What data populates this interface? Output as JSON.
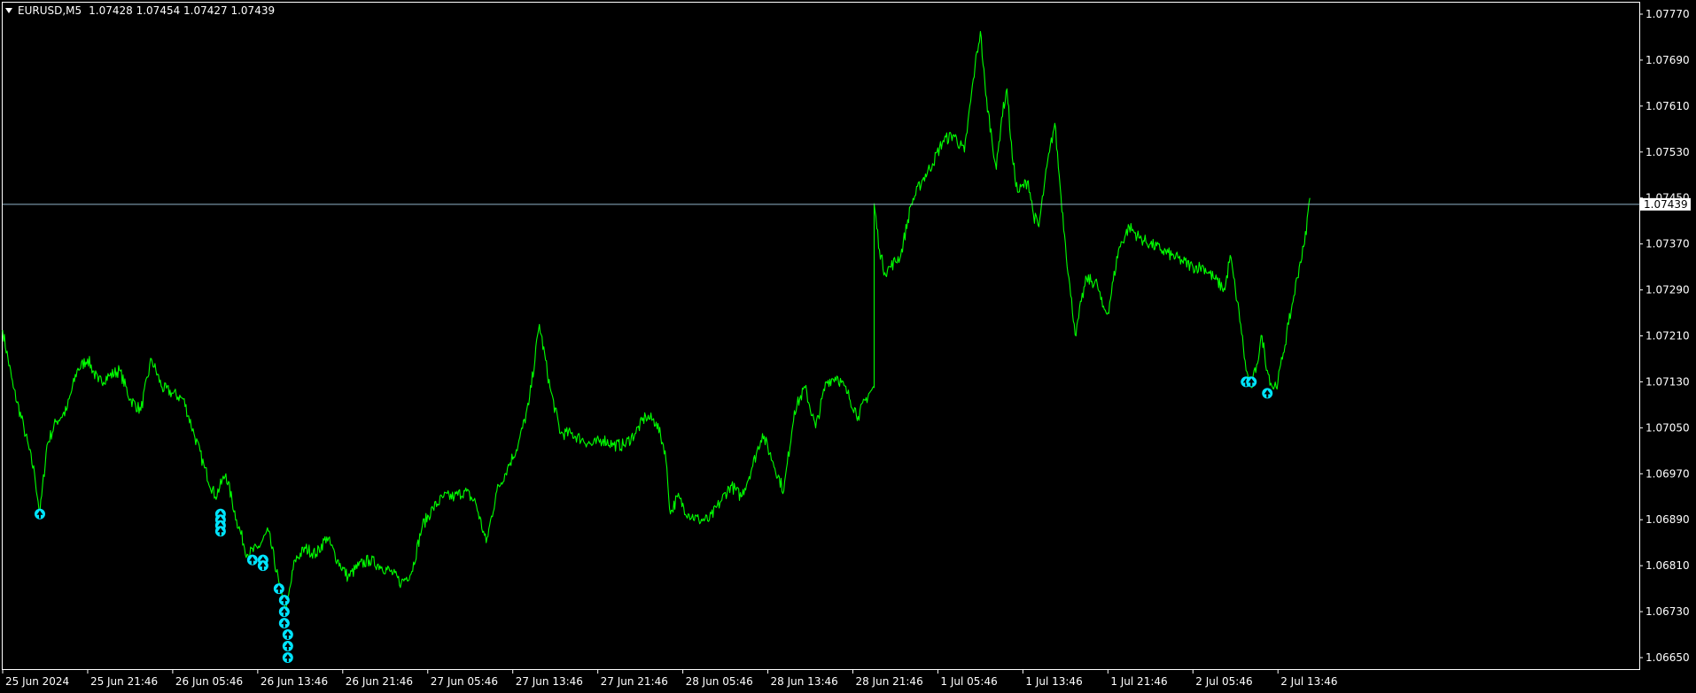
{
  "header": {
    "symbol": "EURUSD,M5",
    "ohlc": "1.07428 1.07454 1.07427 1.07439"
  },
  "chart_data": {
    "type": "line",
    "title": "EURUSD,M5  1.07428 1.07454 1.07427 1.07439",
    "ylim": [
      1.0663,
      1.0779
    ],
    "y_ticks": [
      "1.07770",
      "1.07690",
      "1.07610",
      "1.07530",
      "1.07450",
      "1.07370",
      "1.07290",
      "1.07210",
      "1.07130",
      "1.07050",
      "1.06970",
      "1.06890",
      "1.06810",
      "1.06730",
      "1.06650"
    ],
    "y_tick_values": [
      1.0777,
      1.0769,
      1.0761,
      1.0753,
      1.0745,
      1.0737,
      1.0729,
      1.0721,
      1.0713,
      1.0705,
      1.0697,
      1.0689,
      1.0681,
      1.0673,
      1.0665
    ],
    "x_ticks": [
      "25 Jun 2024",
      "25 Jun 21:46",
      "26 Jun 05:46",
      "26 Jun 13:46",
      "26 Jun 21:46",
      "27 Jun 05:46",
      "27 Jun 13:46",
      "27 Jun 21:46",
      "28 Jun 05:46",
      "28 Jun 13:46",
      "28 Jun 21:46",
      "1 Jul 05:46",
      "1 Jul 13:46",
      "1 Jul 21:46",
      "2 Jul 05:46",
      "2 Jul 13:46"
    ],
    "x_tick_index": [
      0,
      96,
      192,
      288,
      384,
      480,
      576,
      672,
      768,
      864,
      960,
      1056,
      1152,
      1248,
      1344,
      1440
    ],
    "current_price": 1.07439,
    "current_price_label": "1.07439",
    "series": [
      {
        "color": "#00ff00",
        "points": [
          [
            0,
            1.0722
          ],
          [
            12,
            1.0712
          ],
          [
            24,
            1.0705
          ],
          [
            36,
            1.0697
          ],
          [
            42,
            1.069
          ],
          [
            50,
            1.0702
          ],
          [
            60,
            1.0706
          ],
          [
            72,
            1.0708
          ],
          [
            84,
            1.0715
          ],
          [
            96,
            1.0717
          ],
          [
            108,
            1.0713
          ],
          [
            120,
            1.0714
          ],
          [
            132,
            1.0715
          ],
          [
            144,
            1.071
          ],
          [
            156,
            1.0708
          ],
          [
            168,
            1.0717
          ],
          [
            180,
            1.0712
          ],
          [
            192,
            1.0711
          ],
          [
            204,
            1.071
          ],
          [
            216,
            1.0704
          ],
          [
            228,
            1.0698
          ],
          [
            240,
            1.0693
          ],
          [
            252,
            1.0697
          ],
          [
            264,
            1.0689
          ],
          [
            276,
            1.0683
          ],
          [
            288,
            1.0684
          ],
          [
            300,
            1.0687
          ],
          [
            312,
            1.0678
          ],
          [
            320,
            1.0673
          ],
          [
            330,
            1.0682
          ],
          [
            342,
            1.0684
          ],
          [
            354,
            1.0683
          ],
          [
            366,
            1.0686
          ],
          [
            378,
            1.0682
          ],
          [
            390,
            1.0679
          ],
          [
            402,
            1.0681
          ],
          [
            414,
            1.0682
          ],
          [
            426,
            1.0681
          ],
          [
            438,
            1.068
          ],
          [
            450,
            1.0678
          ],
          [
            462,
            1.068
          ],
          [
            474,
            1.0688
          ],
          [
            486,
            1.0691
          ],
          [
            498,
            1.0693
          ],
          [
            510,
            1.0693
          ],
          [
            522,
            1.0694
          ],
          [
            534,
            1.0692
          ],
          [
            546,
            1.0685
          ],
          [
            558,
            1.0694
          ],
          [
            570,
            1.0698
          ],
          [
            582,
            1.0702
          ],
          [
            594,
            1.0709
          ],
          [
            606,
            1.0723
          ],
          [
            618,
            1.0712
          ],
          [
            630,
            1.0704
          ],
          [
            642,
            1.0704
          ],
          [
            654,
            1.0703
          ],
          [
            666,
            1.0702
          ],
          [
            678,
            1.0703
          ],
          [
            690,
            1.0702
          ],
          [
            702,
            1.0702
          ],
          [
            714,
            1.0704
          ],
          [
            726,
            1.0707
          ],
          [
            738,
            1.0706
          ],
          [
            748,
            1.0701
          ],
          [
            754,
            1.069
          ],
          [
            762,
            1.0693
          ],
          [
            774,
            1.069
          ],
          [
            786,
            1.0689
          ],
          [
            798,
            1.0689
          ],
          [
            810,
            1.0692
          ],
          [
            822,
            1.0695
          ],
          [
            834,
            1.0693
          ],
          [
            846,
            1.0698
          ],
          [
            858,
            1.0704
          ],
          [
            870,
            1.0699
          ],
          [
            882,
            1.0694
          ],
          [
            894,
            1.0708
          ],
          [
            906,
            1.0712
          ],
          [
            918,
            1.0705
          ],
          [
            930,
            1.0713
          ],
          [
            942,
            1.0714
          ],
          [
            954,
            1.0711
          ],
          [
            966,
            1.0707
          ],
          [
            978,
            1.0711
          ],
          [
            984,
            1.0712
          ],
          [
            984,
            1.0744
          ],
          [
            990,
            1.0736
          ],
          [
            996,
            1.0732
          ],
          [
            1002,
            1.0733
          ],
          [
            1014,
            1.0735
          ],
          [
            1026,
            1.0744
          ],
          [
            1038,
            1.0748
          ],
          [
            1050,
            1.0751
          ],
          [
            1062,
            1.0755
          ],
          [
            1074,
            1.0756
          ],
          [
            1086,
            1.0753
          ],
          [
            1098,
            1.0768
          ],
          [
            1104,
            1.0774
          ],
          [
            1110,
            1.0763
          ],
          [
            1122,
            1.075
          ],
          [
            1128,
            1.0759
          ],
          [
            1134,
            1.0764
          ],
          [
            1140,
            1.0752
          ],
          [
            1146,
            1.0746
          ],
          [
            1158,
            1.0748
          ],
          [
            1164,
            1.0742
          ],
          [
            1170,
            1.074
          ],
          [
            1176,
            1.0747
          ],
          [
            1182,
            1.0753
          ],
          [
            1188,
            1.0758
          ],
          [
            1194,
            1.0747
          ],
          [
            1200,
            1.0737
          ],
          [
            1206,
            1.0728
          ],
          [
            1212,
            1.0721
          ],
          [
            1218,
            1.0727
          ],
          [
            1224,
            1.0731
          ],
          [
            1236,
            1.073
          ],
          [
            1242,
            1.0726
          ],
          [
            1248,
            1.0725
          ],
          [
            1260,
            1.0736
          ],
          [
            1272,
            1.074
          ],
          [
            1284,
            1.0738
          ],
          [
            1296,
            1.0737
          ],
          [
            1308,
            1.0736
          ],
          [
            1320,
            1.0735
          ],
          [
            1332,
            1.0734
          ],
          [
            1344,
            1.0733
          ],
          [
            1356,
            1.0733
          ],
          [
            1368,
            1.0731
          ],
          [
            1380,
            1.0729
          ],
          [
            1386,
            1.0735
          ],
          [
            1392,
            1.0729
          ],
          [
            1398,
            1.0723
          ],
          [
            1404,
            1.0715
          ],
          [
            1410,
            1.0712
          ],
          [
            1416,
            1.0716
          ],
          [
            1422,
            1.0721
          ],
          [
            1428,
            1.0715
          ],
          [
            1434,
            1.0712
          ],
          [
            1440,
            1.0713
          ],
          [
            1446,
            1.0718
          ],
          [
            1452,
            1.0723
          ],
          [
            1458,
            1.0728
          ],
          [
            1464,
            1.0733
          ],
          [
            1470,
            1.0737
          ],
          [
            1476,
            1.0745
          ]
        ]
      }
    ],
    "arrows": [
      [
        42,
        1.069
      ],
      [
        246,
        1.069
      ],
      [
        246,
        1.0689
      ],
      [
        246,
        1.0688
      ],
      [
        246,
        1.0687
      ],
      [
        282,
        1.0682
      ],
      [
        294,
        1.0682
      ],
      [
        294,
        1.0681
      ],
      [
        312,
        1.0677
      ],
      [
        318,
        1.0675
      ],
      [
        318,
        1.0673
      ],
      [
        318,
        1.0671
      ],
      [
        322,
        1.0669
      ],
      [
        322,
        1.0667
      ],
      [
        322,
        1.0665
      ],
      [
        1404,
        1.0713
      ],
      [
        1410,
        1.0713
      ],
      [
        1428,
        1.0711
      ]
    ],
    "grid": false
  }
}
